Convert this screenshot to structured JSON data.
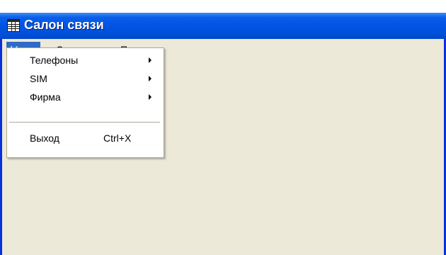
{
  "window": {
    "title": "Салон связи",
    "icon": "table-grid-icon"
  },
  "menubar": {
    "items": [
      {
        "label": "Меню",
        "active": true
      },
      {
        "label": "Отчеты",
        "active": false
      },
      {
        "label": "Помощь",
        "active": false
      }
    ]
  },
  "dropdown": {
    "items": [
      {
        "label": "Телефоны",
        "submenu": true
      },
      {
        "label": "SIM",
        "submenu": true
      },
      {
        "label": "Фирма",
        "submenu": true
      }
    ],
    "exit": {
      "label": "Выход",
      "shortcut": "Ctrl+X"
    }
  },
  "colors": {
    "titlebar": "#0054e3",
    "highlight": "#316ac5",
    "face": "#ece9d8"
  }
}
